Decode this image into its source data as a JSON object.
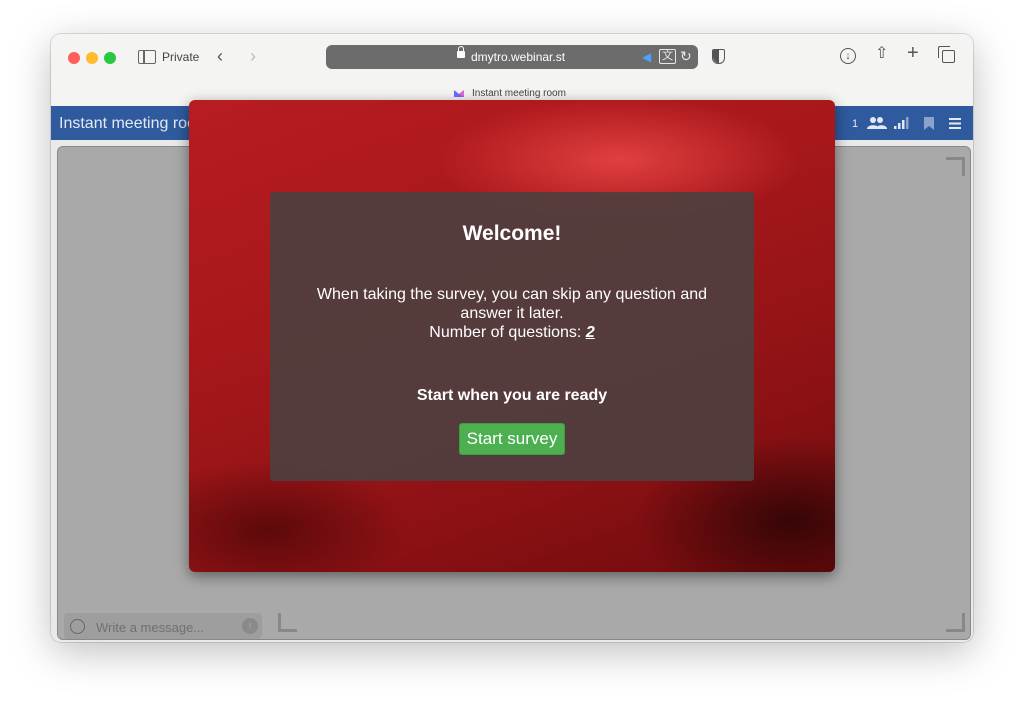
{
  "browser": {
    "mode_label": "Private",
    "url": "dmytro.webinar.st",
    "tab_title": "Instant meeting room",
    "icons": [
      "sidebar-icon",
      "back-icon",
      "forward-icon",
      "lock-icon",
      "speaker-icon",
      "translate-icon",
      "reload-icon",
      "shield-icon",
      "download-icon",
      "share-icon",
      "new-tab-icon",
      "tabs-overview-icon"
    ]
  },
  "room": {
    "title": "Instant meeting room",
    "participants_count": "1",
    "colors": {
      "topbar": "#2f5a9e",
      "panel": "#a9a9a9"
    }
  },
  "chat": {
    "placeholder": "Write a message..."
  },
  "survey": {
    "title": "Welcome!",
    "description": "When taking the survey, you can skip any question and answer it later.",
    "questions_label": "Number of questions:",
    "questions_count": "2",
    "ready_text": "Start when you are ready",
    "start_button": "Start survey",
    "colors": {
      "button": "#4caf50",
      "background": "#a8181b"
    }
  }
}
